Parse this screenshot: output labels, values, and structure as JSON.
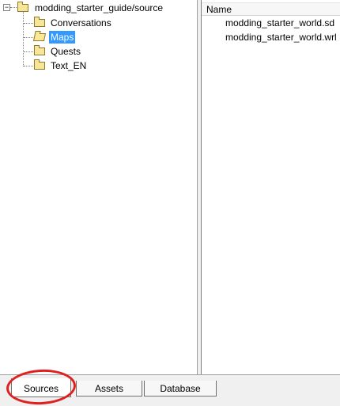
{
  "tree": {
    "root": {
      "label": "modding_starter_guide/source",
      "expander": "−"
    },
    "children": [
      {
        "label": "Conversations",
        "selected": false
      },
      {
        "label": "Maps",
        "selected": true
      },
      {
        "label": "Quests",
        "selected": false
      },
      {
        "label": "Text_EN",
        "selected": false
      }
    ]
  },
  "list": {
    "column_header": "Name",
    "files": [
      {
        "name": "modding_starter_world.sd"
      },
      {
        "name": "modding_starter_world.wrl"
      }
    ]
  },
  "tabs": [
    {
      "label": "Sources",
      "active": true
    },
    {
      "label": "Assets",
      "active": false
    },
    {
      "label": "Database",
      "active": false
    }
  ],
  "colors": {
    "selection": "#3399ff",
    "highlight_circle": "#e0201f",
    "folder": "#f7e59a"
  }
}
